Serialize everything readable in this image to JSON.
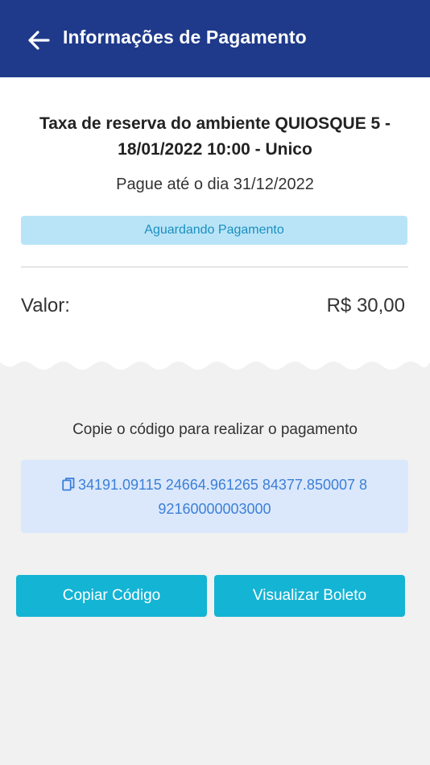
{
  "header": {
    "title": "Informações de Pagamento",
    "back_icon": "arrow-left-icon"
  },
  "charge": {
    "title": "Taxa de reserva do ambiente QUIOSQUE 5 - 18/01/2022 10:00 - Unico",
    "due_date": "Pague até o dia 31/12/2022",
    "status": "Aguardando Pagamento",
    "value_label": "Valor:",
    "value_amount": "R$ 30,00"
  },
  "payment": {
    "instruction": "Copie o código para realizar o pagamento",
    "barcode": "34191.09115 24664.961265 84377.850007 8 92160000003000",
    "copy_icon": "copy-icon"
  },
  "actions": {
    "copy_label": "Copiar Código",
    "view_label": "Visualizar Boleto"
  },
  "colors": {
    "app_bar": "#1f3a8a",
    "status_bg": "#b9e4f8",
    "status_text": "#1a8fc0",
    "code_bg": "#dbe8fb",
    "code_text": "#3b7fd8",
    "button": "#14b4d4"
  }
}
